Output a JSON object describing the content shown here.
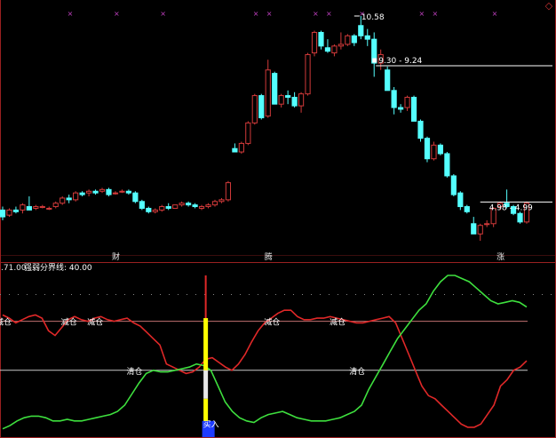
{
  "colors": {
    "background": "#000000",
    "up": "#d23a3a",
    "down": "#54ffff",
    "frame": "#9a2020",
    "strong_line": "#e02828",
    "weak_line": "#3ee03e",
    "ref_line": "#c8c8c8",
    "label": "#ffffff",
    "signal_bar": "#ffff00",
    "buy_box": "#1e3cff"
  },
  "corner_icon": "diamond-icon",
  "price_annotations": {
    "high": "10.58",
    "mid_range": "9.30 - 9.24",
    "low_range": "4.98 - 4.99"
  },
  "event_markers": [
    "财",
    "腾",
    "涨"
  ],
  "indicator": {
    "header_value": ".71.00",
    "header_name": "强弱分界线: 40.00",
    "signal_labels": [
      "减仓",
      "减仓",
      "减仓",
      "减仓",
      "减仓",
      "清仓",
      "清仓"
    ],
    "buy_label": "买入"
  },
  "chart_data": [
    {
      "type": "candlestick",
      "series": [
        {
          "o": 4.9,
          "h": 5.0,
          "l": 4.6,
          "c": 4.7
        },
        {
          "o": 4.75,
          "h": 4.95,
          "l": 4.7,
          "c": 4.9
        },
        {
          "o": 4.9,
          "h": 5.0,
          "l": 4.8,
          "c": 4.85
        },
        {
          "o": 4.9,
          "h": 5.1,
          "l": 4.8,
          "c": 5.05
        },
        {
          "o": 5.0,
          "h": 5.3,
          "l": 4.95,
          "c": 4.9
        },
        {
          "o": 4.95,
          "h": 5.05,
          "l": 4.9,
          "c": 5.0
        },
        {
          "o": 5.0,
          "h": 5.05,
          "l": 4.95,
          "c": 5.0
        },
        {
          "o": 4.95,
          "h": 5.0,
          "l": 4.9,
          "c": 4.95
        },
        {
          "o": 5.0,
          "h": 5.15,
          "l": 4.95,
          "c": 5.1
        },
        {
          "o": 5.1,
          "h": 5.3,
          "l": 5.05,
          "c": 5.25
        },
        {
          "o": 5.25,
          "h": 5.35,
          "l": 5.1,
          "c": 5.2
        },
        {
          "o": 5.2,
          "h": 5.45,
          "l": 5.15,
          "c": 5.4
        },
        {
          "o": 5.4,
          "h": 5.45,
          "l": 5.3,
          "c": 5.35
        },
        {
          "o": 5.4,
          "h": 5.5,
          "l": 5.3,
          "c": 5.45
        },
        {
          "o": 5.45,
          "h": 5.5,
          "l": 5.35,
          "c": 5.4
        },
        {
          "o": 5.45,
          "h": 5.55,
          "l": 5.4,
          "c": 5.5
        },
        {
          "o": 5.5,
          "h": 5.55,
          "l": 5.3,
          "c": 5.35
        },
        {
          "o": 5.4,
          "h": 5.45,
          "l": 5.35,
          "c": 5.4
        },
        {
          "o": 5.45,
          "h": 5.5,
          "l": 5.4,
          "c": 5.45
        },
        {
          "o": 5.45,
          "h": 5.5,
          "l": 5.35,
          "c": 5.4
        },
        {
          "o": 5.4,
          "h": 5.45,
          "l": 5.1,
          "c": 5.15
        },
        {
          "o": 5.15,
          "h": 5.2,
          "l": 4.9,
          "c": 4.95
        },
        {
          "o": 4.95,
          "h": 5.0,
          "l": 4.8,
          "c": 4.85
        },
        {
          "o": 4.85,
          "h": 4.95,
          "l": 4.8,
          "c": 4.9
        },
        {
          "o": 4.9,
          "h": 5.05,
          "l": 4.85,
          "c": 5.0
        },
        {
          "o": 5.0,
          "h": 5.1,
          "l": 4.9,
          "c": 4.95
        },
        {
          "o": 4.95,
          "h": 5.05,
          "l": 4.95,
          "c": 5.05
        },
        {
          "o": 5.05,
          "h": 5.15,
          "l": 5.0,
          "c": 5.1
        },
        {
          "o": 5.1,
          "h": 5.15,
          "l": 5.0,
          "c": 5.05
        },
        {
          "o": 5.05,
          "h": 5.1,
          "l": 4.95,
          "c": 5.0
        },
        {
          "o": 4.95,
          "h": 5.05,
          "l": 4.9,
          "c": 5.0
        },
        {
          "o": 5.0,
          "h": 5.1,
          "l": 4.95,
          "c": 5.05
        },
        {
          "o": 5.05,
          "h": 5.2,
          "l": 5.0,
          "c": 5.15
        },
        {
          "o": 5.15,
          "h": 5.25,
          "l": 5.1,
          "c": 5.2
        },
        {
          "o": 5.2,
          "h": 5.75,
          "l": 5.15,
          "c": 5.7
        },
        {
          "o": 6.7,
          "h": 6.85,
          "l": 6.6,
          "c": 6.6
        },
        {
          "o": 6.6,
          "h": 6.9,
          "l": 6.55,
          "c": 6.85
        },
        {
          "o": 6.85,
          "h": 7.5,
          "l": 6.8,
          "c": 7.45
        },
        {
          "o": 7.45,
          "h": 8.3,
          "l": 7.4,
          "c": 8.25
        },
        {
          "o": 8.25,
          "h": 8.3,
          "l": 7.55,
          "c": 7.6
        },
        {
          "o": 7.65,
          "h": 9.3,
          "l": 7.6,
          "c": 9.0
        },
        {
          "o": 8.9,
          "h": 8.95,
          "l": 8.0,
          "c": 8.0
        },
        {
          "o": 8.0,
          "h": 8.3,
          "l": 7.9,
          "c": 8.25
        },
        {
          "o": 8.25,
          "h": 8.4,
          "l": 8.0,
          "c": 8.2
        },
        {
          "o": 8.2,
          "h": 8.35,
          "l": 7.9,
          "c": 7.95
        },
        {
          "o": 7.95,
          "h": 8.35,
          "l": 7.75,
          "c": 8.3
        },
        {
          "o": 8.3,
          "h": 9.5,
          "l": 8.25,
          "c": 9.45
        },
        {
          "o": 9.5,
          "h": 10.15,
          "l": 9.4,
          "c": 10.1
        },
        {
          "o": 10.1,
          "h": 10.15,
          "l": 9.6,
          "c": 9.7
        },
        {
          "o": 9.65,
          "h": 9.9,
          "l": 9.5,
          "c": 9.55
        },
        {
          "o": 9.5,
          "h": 9.75,
          "l": 9.4,
          "c": 9.7
        },
        {
          "o": 9.7,
          "h": 10.1,
          "l": 9.6,
          "c": 9.75
        },
        {
          "o": 9.75,
          "h": 10.05,
          "l": 9.7,
          "c": 10.0
        },
        {
          "o": 10.0,
          "h": 10.05,
          "l": 9.7,
          "c": 9.8
        },
        {
          "o": 10.3,
          "h": 10.58,
          "l": 9.9,
          "c": 10.0
        },
        {
          "o": 10.0,
          "h": 10.2,
          "l": 9.7,
          "c": 9.9
        },
        {
          "o": 9.9,
          "h": 10.1,
          "l": 8.8,
          "c": 9.2
        },
        {
          "o": 9.2,
          "h": 9.6,
          "l": 9.0,
          "c": 9.45
        },
        {
          "o": 9.0,
          "h": 9.1,
          "l": 8.4,
          "c": 8.4
        },
        {
          "o": 8.4,
          "h": 8.5,
          "l": 7.7,
          "c": 7.9
        },
        {
          "o": 7.9,
          "h": 8.0,
          "l": 7.75,
          "c": 7.85
        },
        {
          "o": 7.9,
          "h": 8.25,
          "l": 7.8,
          "c": 8.2
        },
        {
          "o": 8.2,
          "h": 8.25,
          "l": 7.5,
          "c": 7.5
        },
        {
          "o": 7.5,
          "h": 7.55,
          "l": 6.9,
          "c": 7.0
        },
        {
          "o": 7.0,
          "h": 7.05,
          "l": 6.3,
          "c": 6.4
        },
        {
          "o": 6.4,
          "h": 6.9,
          "l": 6.35,
          "c": 6.8
        },
        {
          "o": 6.8,
          "h": 6.85,
          "l": 6.5,
          "c": 6.55
        },
        {
          "o": 6.55,
          "h": 6.6,
          "l": 5.85,
          "c": 5.9
        },
        {
          "o": 5.9,
          "h": 5.95,
          "l": 5.3,
          "c": 5.35
        },
        {
          "o": 5.4,
          "h": 5.45,
          "l": 4.9,
          "c": 5.0
        },
        {
          "o": 5.0,
          "h": 5.05,
          "l": 4.8,
          "c": 4.85
        },
        {
          "o": 4.5,
          "h": 4.7,
          "l": 4.2,
          "c": 4.2
        },
        {
          "o": 4.2,
          "h": 4.5,
          "l": 4.0,
          "c": 4.45
        },
        {
          "o": 4.5,
          "h": 4.6,
          "l": 4.4,
          "c": 4.5
        },
        {
          "o": 4.5,
          "h": 4.98,
          "l": 4.4,
          "c": 4.95
        },
        {
          "o": 5.0,
          "h": 5.15,
          "l": 4.9,
          "c": 5.1
        },
        {
          "o": 5.1,
          "h": 5.5,
          "l": 4.95,
          "c": 5.0
        },
        {
          "o": 5.0,
          "h": 5.05,
          "l": 4.75,
          "c": 4.8
        },
        {
          "o": 4.8,
          "h": 4.85,
          "l": 4.5,
          "c": 4.55
        },
        {
          "o": 4.55,
          "h": 5.15,
          "l": 4.5,
          "c": 5.1
        }
      ],
      "event_marker_indices": [
        17,
        40,
        75
      ]
    },
    {
      "type": "line",
      "title": "强弱分界线",
      "reference_levels": [
        71.0,
        40.0
      ],
      "series": [
        {
          "values": [
            75,
            73,
            70,
            72,
            74,
            75,
            73,
            65,
            62,
            67,
            72,
            74,
            72,
            71,
            73,
            74,
            72,
            71,
            72,
            73,
            70,
            68,
            64,
            60,
            56,
            44,
            42,
            40,
            38,
            39,
            42,
            47,
            48,
            45,
            42,
            40,
            44,
            50,
            58,
            65,
            70,
            73,
            76,
            78,
            78,
            74,
            72,
            72,
            73,
            73,
            74,
            73,
            72,
            71,
            70,
            70,
            71,
            72,
            73,
            74,
            70,
            60,
            50,
            40,
            30,
            24,
            22,
            18,
            14,
            10,
            6,
            4,
            4,
            6,
            12,
            18,
            30,
            34,
            40,
            42,
            46
          ]
        },
        {
          "values": [
            3,
            5,
            8,
            10,
            11,
            11,
            10,
            8,
            8,
            9,
            8,
            8,
            9,
            10,
            11,
            12,
            14,
            18,
            25,
            32,
            38,
            40,
            39,
            39,
            40,
            41,
            42,
            44,
            43,
            40,
            30,
            20,
            14,
            10,
            8,
            7,
            10,
            12,
            13,
            14,
            12,
            10,
            9,
            8,
            8,
            8,
            9,
            10,
            12,
            14,
            18,
            28,
            36,
            44,
            52,
            60,
            66,
            72,
            78,
            82,
            90,
            96,
            100,
            100,
            98,
            96,
            92,
            88,
            84,
            82,
            83,
            84,
            83,
            80
          ]
        }
      ],
      "markers": {
        "buy_index": 31
      }
    }
  ]
}
